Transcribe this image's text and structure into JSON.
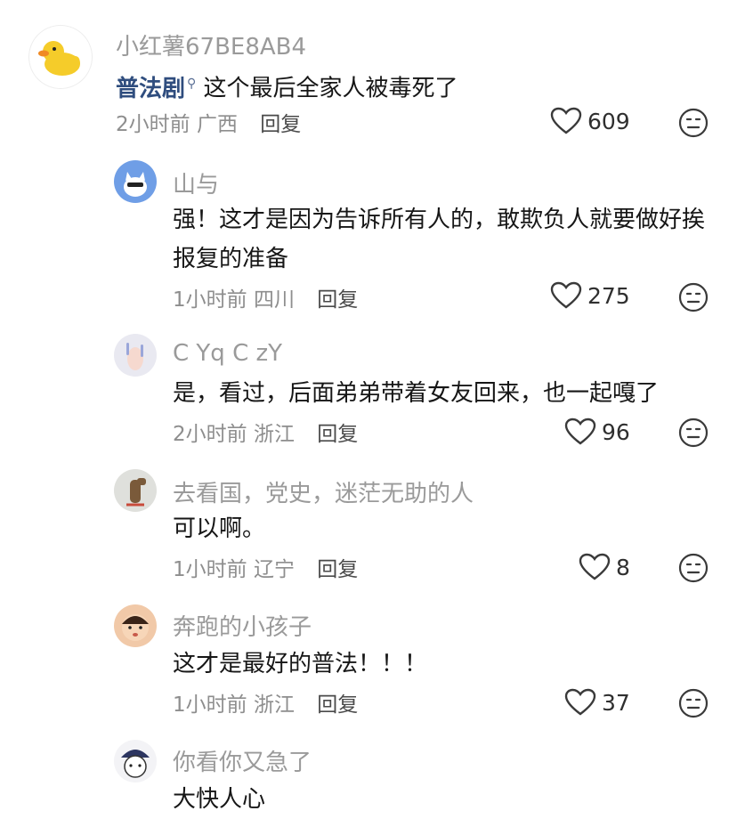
{
  "comments": [
    {
      "user": "小红薯67BE8AB4",
      "link": "普法剧",
      "text": "这个最后全家人被毒死了",
      "time": "2小时前",
      "location": "广西",
      "reply": "回复",
      "likes": "609",
      "avatar": "duck-avatar"
    },
    {
      "user": "山与",
      "text": "强！这才是因为告诉所有人的，敢欺负人就要做好挨报复的准备",
      "time": "1小时前",
      "location": "四川",
      "reply": "回复",
      "likes": "275",
      "avatar": "cat-avatar"
    },
    {
      "user": "C Yq C zY",
      "text": "是，看过，后面弟弟带着女友回来，也一起嘎了",
      "time": "2小时前",
      "location": "浙江",
      "reply": "回复",
      "likes": "96",
      "avatar": "hand-avatar"
    },
    {
      "user": "去看国，党史，迷茫无助的人",
      "text": "可以啊。",
      "time": "1小时前",
      "location": "辽宁",
      "reply": "回复",
      "likes": "8",
      "avatar": "horse-avatar"
    },
    {
      "user": "奔跑的小孩子",
      "text": "这才是最好的普法！！！",
      "time": "1小时前",
      "location": "浙江",
      "reply": "回复",
      "likes": "37",
      "avatar": "child-avatar"
    },
    {
      "user": "你看你又急了",
      "text": "大快人心",
      "avatar": "cartoon-avatar"
    }
  ],
  "colors": {
    "name": "#9a9a9a",
    "text": "#161616",
    "link": "#2f4d7e",
    "duck": "#f5cc2a"
  }
}
